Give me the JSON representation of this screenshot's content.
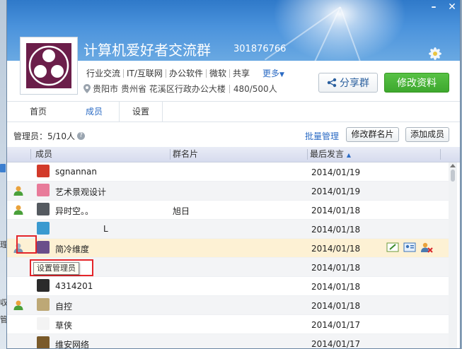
{
  "group": {
    "title": "计算机爱好者交流群",
    "id": "301876766",
    "tags": [
      "行业交流",
      "IT/互联网",
      "办公软件",
      "微软",
      "共享"
    ],
    "more": "更多",
    "location_city": "贵阳市",
    "location_detail": "贵州省 花溪区行政办公大楼",
    "member_count": "480/500人"
  },
  "actions": {
    "share": "分享群",
    "edit": "修改资料"
  },
  "tabs": [
    "首页",
    "成员",
    "设置"
  ],
  "active_tab": "成员",
  "toolbar": {
    "admin_count": "管理员：5/10人",
    "batch_manage": "批量管理",
    "modify_card": "修改群名片",
    "add_member": "添加成员"
  },
  "table": {
    "headers": {
      "member": "成员",
      "card": "群名片",
      "last_post": "最后发言"
    },
    "sort": "last_post-descending",
    "rows": [
      {
        "name": "sgnannan",
        "card": "",
        "date": "2014/01/19",
        "admin": false,
        "avatar_color": "#d23a2a"
      },
      {
        "name": "艺术景观设计",
        "card": "",
        "date": "2014/01/19",
        "admin": true,
        "avatar_color": "#e87b9a"
      },
      {
        "name": "异时空。。",
        "card": "旭日",
        "date": "2014/01/18",
        "admin": true,
        "avatar_color": "#555a60"
      },
      {
        "name": "L",
        "card": "",
        "date": "2014/01/18",
        "admin": false,
        "avatar_color": "#3a9ad0"
      },
      {
        "name": "简冷维度",
        "card": "",
        "date": "2014/01/18",
        "admin": false,
        "selected": true,
        "avatar_color": "#6b4e8a"
      },
      {
        "name": "",
        "card": "",
        "date": "2014/01/18",
        "admin": false,
        "avatar_color": ""
      },
      {
        "name": "4314201",
        "card": "",
        "date": "2014/01/18",
        "admin": false,
        "avatar_color": "#2b2b2b"
      },
      {
        "name": "自控",
        "card": "",
        "date": "2014/01/18",
        "admin": true,
        "avatar_color": "#bda876"
      },
      {
        "name": "草侠",
        "card": "",
        "date": "2014/01/17",
        "admin": false,
        "avatar_color": "#f3f3f3"
      },
      {
        "name": "维安网络",
        "card": "",
        "date": "2014/01/17",
        "admin": false,
        "avatar_color": "#7a5a2a"
      }
    ]
  },
  "tooltip": "设置管理员",
  "background_glyphs": [
    "理",
    "収",
    "管"
  ]
}
